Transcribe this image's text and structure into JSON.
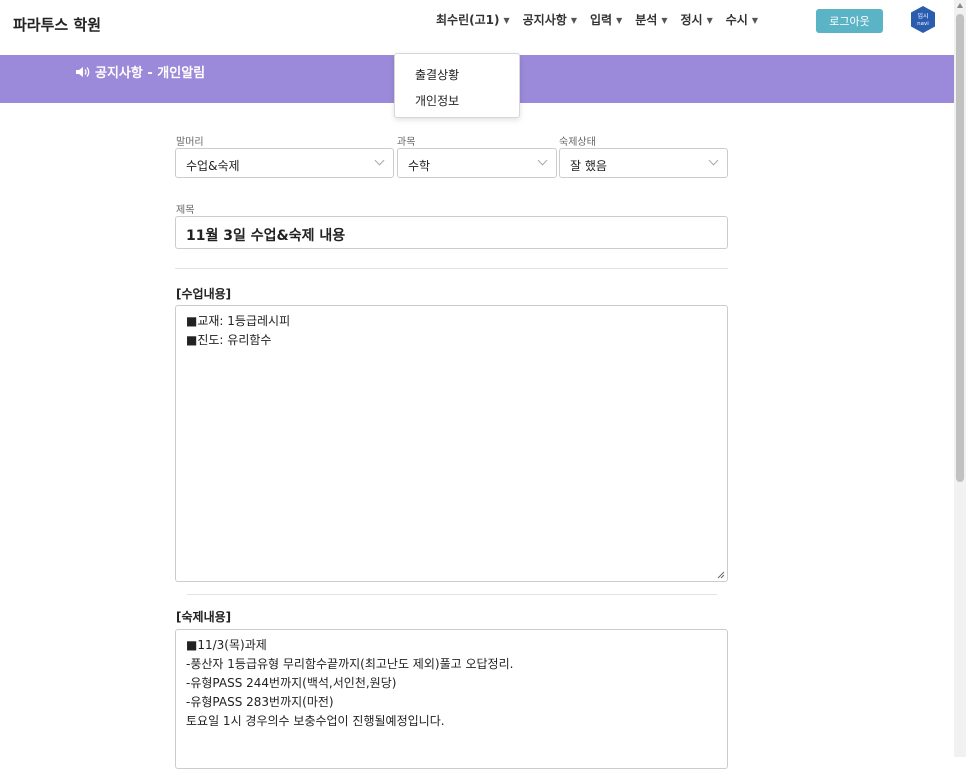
{
  "brand": "파라투스 학원",
  "nav": {
    "items": [
      {
        "label": "최수린(고1)"
      },
      {
        "label": "공지사항"
      },
      {
        "label": "입력"
      },
      {
        "label": "분석"
      },
      {
        "label": "정시"
      },
      {
        "label": "수시"
      }
    ],
    "logout_label": "로그아웃",
    "logo_text_1": "입시",
    "logo_text_2": "navi"
  },
  "dropdown": {
    "items": [
      {
        "label": "출결상황"
      },
      {
        "label": "개인정보"
      }
    ]
  },
  "banner": {
    "icon": "speaker-icon",
    "title": "공지사항 - 개인알림"
  },
  "form": {
    "header_label": "말머리",
    "header_value": "수업&숙제",
    "subject_label": "과목",
    "subject_value": "수학",
    "hw_status_label": "숙제상태",
    "hw_status_value": "잘 했음",
    "title_label": "제목",
    "title_value": "11월 3일 수업&숙제 내용",
    "class_section": "[수업내용]",
    "class_lines": [
      "■교재: 1등급레시피",
      "■진도: 유리함수"
    ],
    "hw_section": "[숙제내용]",
    "hw_lines": [
      "■11/3(목)과제",
      "-풍산자 1등급유형 무리함수끝까지(최고난도 제외)풀고 오답정리.",
      "-유형PASS 244번까지(백석,서인천,원당)",
      "-유형PASS 283번까지(마전)",
      "토요일 1시 경우의수 보충수업이 진행될예정입니다."
    ]
  },
  "colors": {
    "banner": "#9a8ad9",
    "logout": "#5bb3c6",
    "logo": "#2a5db0"
  }
}
